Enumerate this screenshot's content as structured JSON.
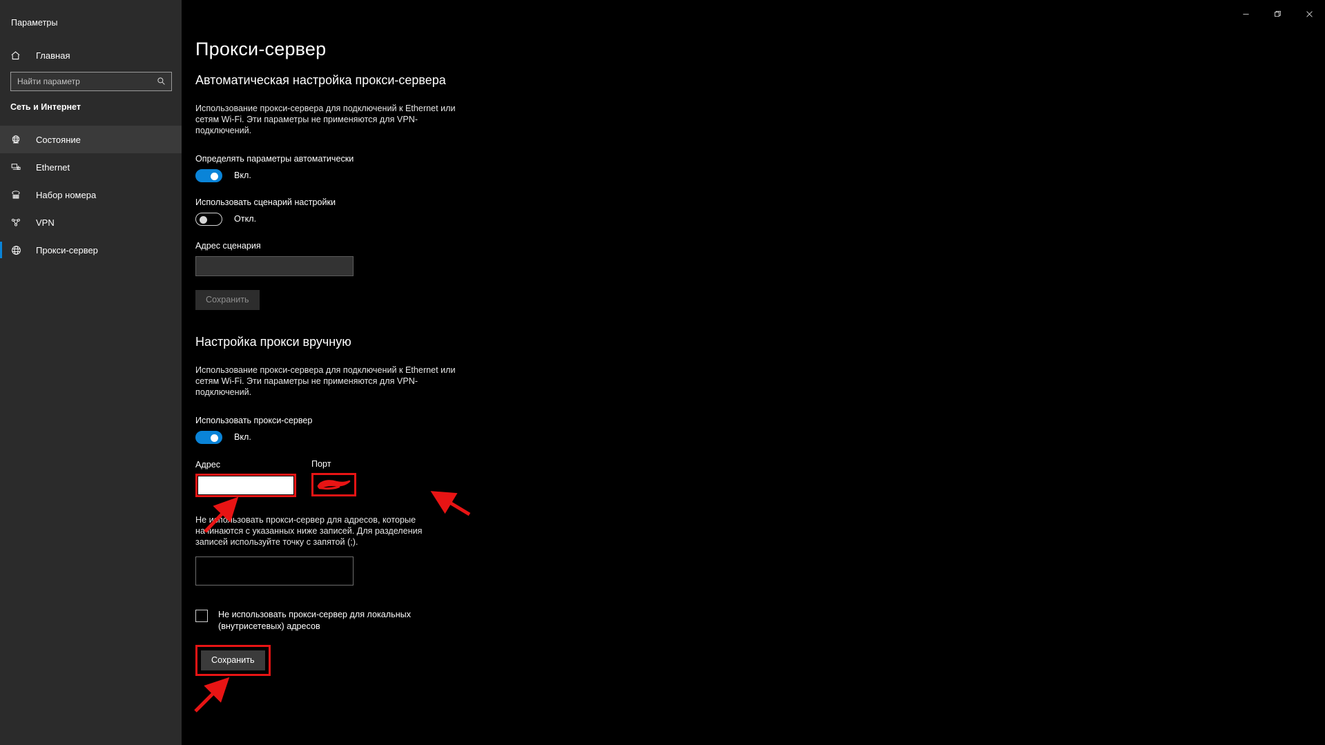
{
  "window": {
    "app_title": "Параметры",
    "controls": [
      {
        "name": "minimize",
        "glyph": "minimize-icon"
      },
      {
        "name": "maximize",
        "glyph": "maximize-icon"
      },
      {
        "name": "close",
        "glyph": "close-icon"
      }
    ]
  },
  "sidebar": {
    "home_label": "Главная",
    "home_icon": "home-icon",
    "search": {
      "placeholder": "Найти параметр",
      "value": "",
      "icon": "search-icon"
    },
    "category": "Сеть и Интернет",
    "items": [
      {
        "label": "Состояние",
        "icon": "globe-status-icon",
        "selected": false,
        "hovered": true
      },
      {
        "label": "Ethernet",
        "icon": "ethernet-icon",
        "selected": false,
        "hovered": false
      },
      {
        "label": "Набор номера",
        "icon": "dialup-phone-icon",
        "selected": false,
        "hovered": false
      },
      {
        "label": "VPN",
        "icon": "vpn-icon",
        "selected": false,
        "hovered": false
      },
      {
        "label": "Прокси-сервер",
        "icon": "globe-proxy-icon",
        "selected": true,
        "hovered": false
      }
    ]
  },
  "main": {
    "page_title": "Прокси-сервер",
    "auto": {
      "heading": "Автоматическая настройка прокси-сервера",
      "description": "Использование прокси-сервера для подключений к Ethernet или сетям Wi-Fi. Эти параметры не применяются для VPN-подключений.",
      "detect_label": "Определять параметры автоматически",
      "detect_state": "Вкл.",
      "detect_on": true,
      "script_label": "Использовать сценарий настройки",
      "script_state": "Откл.",
      "script_on": false,
      "script_address_label": "Адрес сценария",
      "script_address_value": "",
      "save_label": "Сохранить",
      "save_disabled": true
    },
    "manual": {
      "heading": "Настройка прокси вручную",
      "description": "Использование прокси-сервера для подключений к Ethernet или сетям Wi-Fi. Эти параметры не применяются для VPN-подключений.",
      "use_proxy_label": "Использовать прокси-сервер",
      "use_proxy_state": "Вкл.",
      "use_proxy_on": true,
      "address_label": "Адрес",
      "address_value": "",
      "address_focused": true,
      "port_label": "Порт",
      "port_value": "",
      "port_redacted": true,
      "exceptions_description": "Не использовать прокси-сервер для адресов, которые начинаются с указанных ниже записей. Для разделения записей используйте точку с запятой (;).",
      "exceptions_value": "",
      "local_bypass_label": "Не использовать прокси-сервер для локальных (внутрисетевых) адресов",
      "local_bypass_checked": false,
      "save_label": "Сохранить",
      "save_highlighted": true
    }
  },
  "annotations": {
    "accent_red": "#e81414",
    "accent_blue": "#0a84d8",
    "arrow_count": 3
  }
}
